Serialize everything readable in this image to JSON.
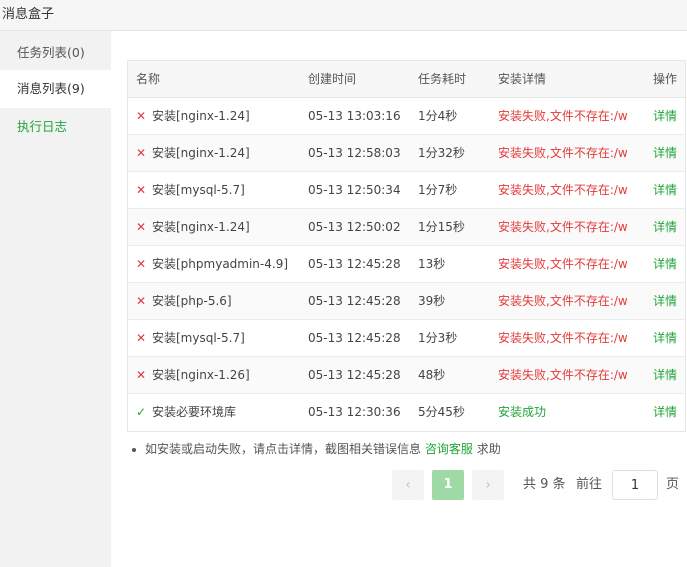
{
  "window": {
    "title": "消息盒子"
  },
  "sidebar": {
    "items": [
      {
        "label": "任务列表(0)"
      },
      {
        "label": "消息列表(9)"
      },
      {
        "label": "执行日志"
      }
    ]
  },
  "table": {
    "headers": [
      "名称",
      "创建时间",
      "任务耗时",
      "安装详情",
      "操作"
    ],
    "rows": [
      {
        "status": "fail",
        "icon": "✕",
        "name": "安装[nginx-1.24]",
        "time": "05-13 13:03:16",
        "duration": "1分4秒",
        "detail": "安装失败,文件不存在:/ww",
        "action": "详情"
      },
      {
        "status": "fail",
        "icon": "✕",
        "name": "安装[nginx-1.24]",
        "time": "05-13 12:58:03",
        "duration": "1分32秒",
        "detail": "安装失败,文件不存在:/ww",
        "action": "详情"
      },
      {
        "status": "fail",
        "icon": "✕",
        "name": "安装[mysql-5.7]",
        "time": "05-13 12:50:34",
        "duration": "1分7秒",
        "detail": "安装失败,文件不存在:/ww",
        "action": "详情"
      },
      {
        "status": "fail",
        "icon": "✕",
        "name": "安装[nginx-1.24]",
        "time": "05-13 12:50:02",
        "duration": "1分15秒",
        "detail": "安装失败,文件不存在:/ww",
        "action": "详情"
      },
      {
        "status": "fail",
        "icon": "✕",
        "name": "安装[phpmyadmin-4.9]",
        "time": "05-13 12:45:28",
        "duration": "13秒",
        "detail": "安装失败,文件不存在:/ww",
        "action": "详情"
      },
      {
        "status": "fail",
        "icon": "✕",
        "name": "安装[php-5.6]",
        "time": "05-13 12:45:28",
        "duration": "39秒",
        "detail": "安装失败,文件不存在:/ww",
        "action": "详情"
      },
      {
        "status": "fail",
        "icon": "✕",
        "name": "安装[mysql-5.7]",
        "time": "05-13 12:45:28",
        "duration": "1分3秒",
        "detail": "安装失败,文件不存在:/ww",
        "action": "详情"
      },
      {
        "status": "fail",
        "icon": "✕",
        "name": "安装[nginx-1.26]",
        "time": "05-13 12:45:28",
        "duration": "48秒",
        "detail": "安装失败,文件不存在:/ww",
        "action": "详情"
      },
      {
        "status": "ok",
        "icon": "✓",
        "name": "安装必要环境库",
        "time": "05-13 12:30:36",
        "duration": "5分45秒",
        "detail": "安装成功",
        "action": "详情"
      }
    ]
  },
  "note": {
    "text_before": "如安装或启动失败，请点击详情，截图相关错误信息",
    "link": "咨询客服",
    "text_after": "求助"
  },
  "pager": {
    "prev_icon": "‹",
    "current_page": "1",
    "next_icon": "›",
    "total_text": "共 9 条",
    "goto_label": "前往",
    "goto_value": "1",
    "unit_label": "页"
  },
  "colors": {
    "accent": "#20a53a",
    "fail": "#e33b3b",
    "current_page_bg": "#9fd9a6"
  }
}
